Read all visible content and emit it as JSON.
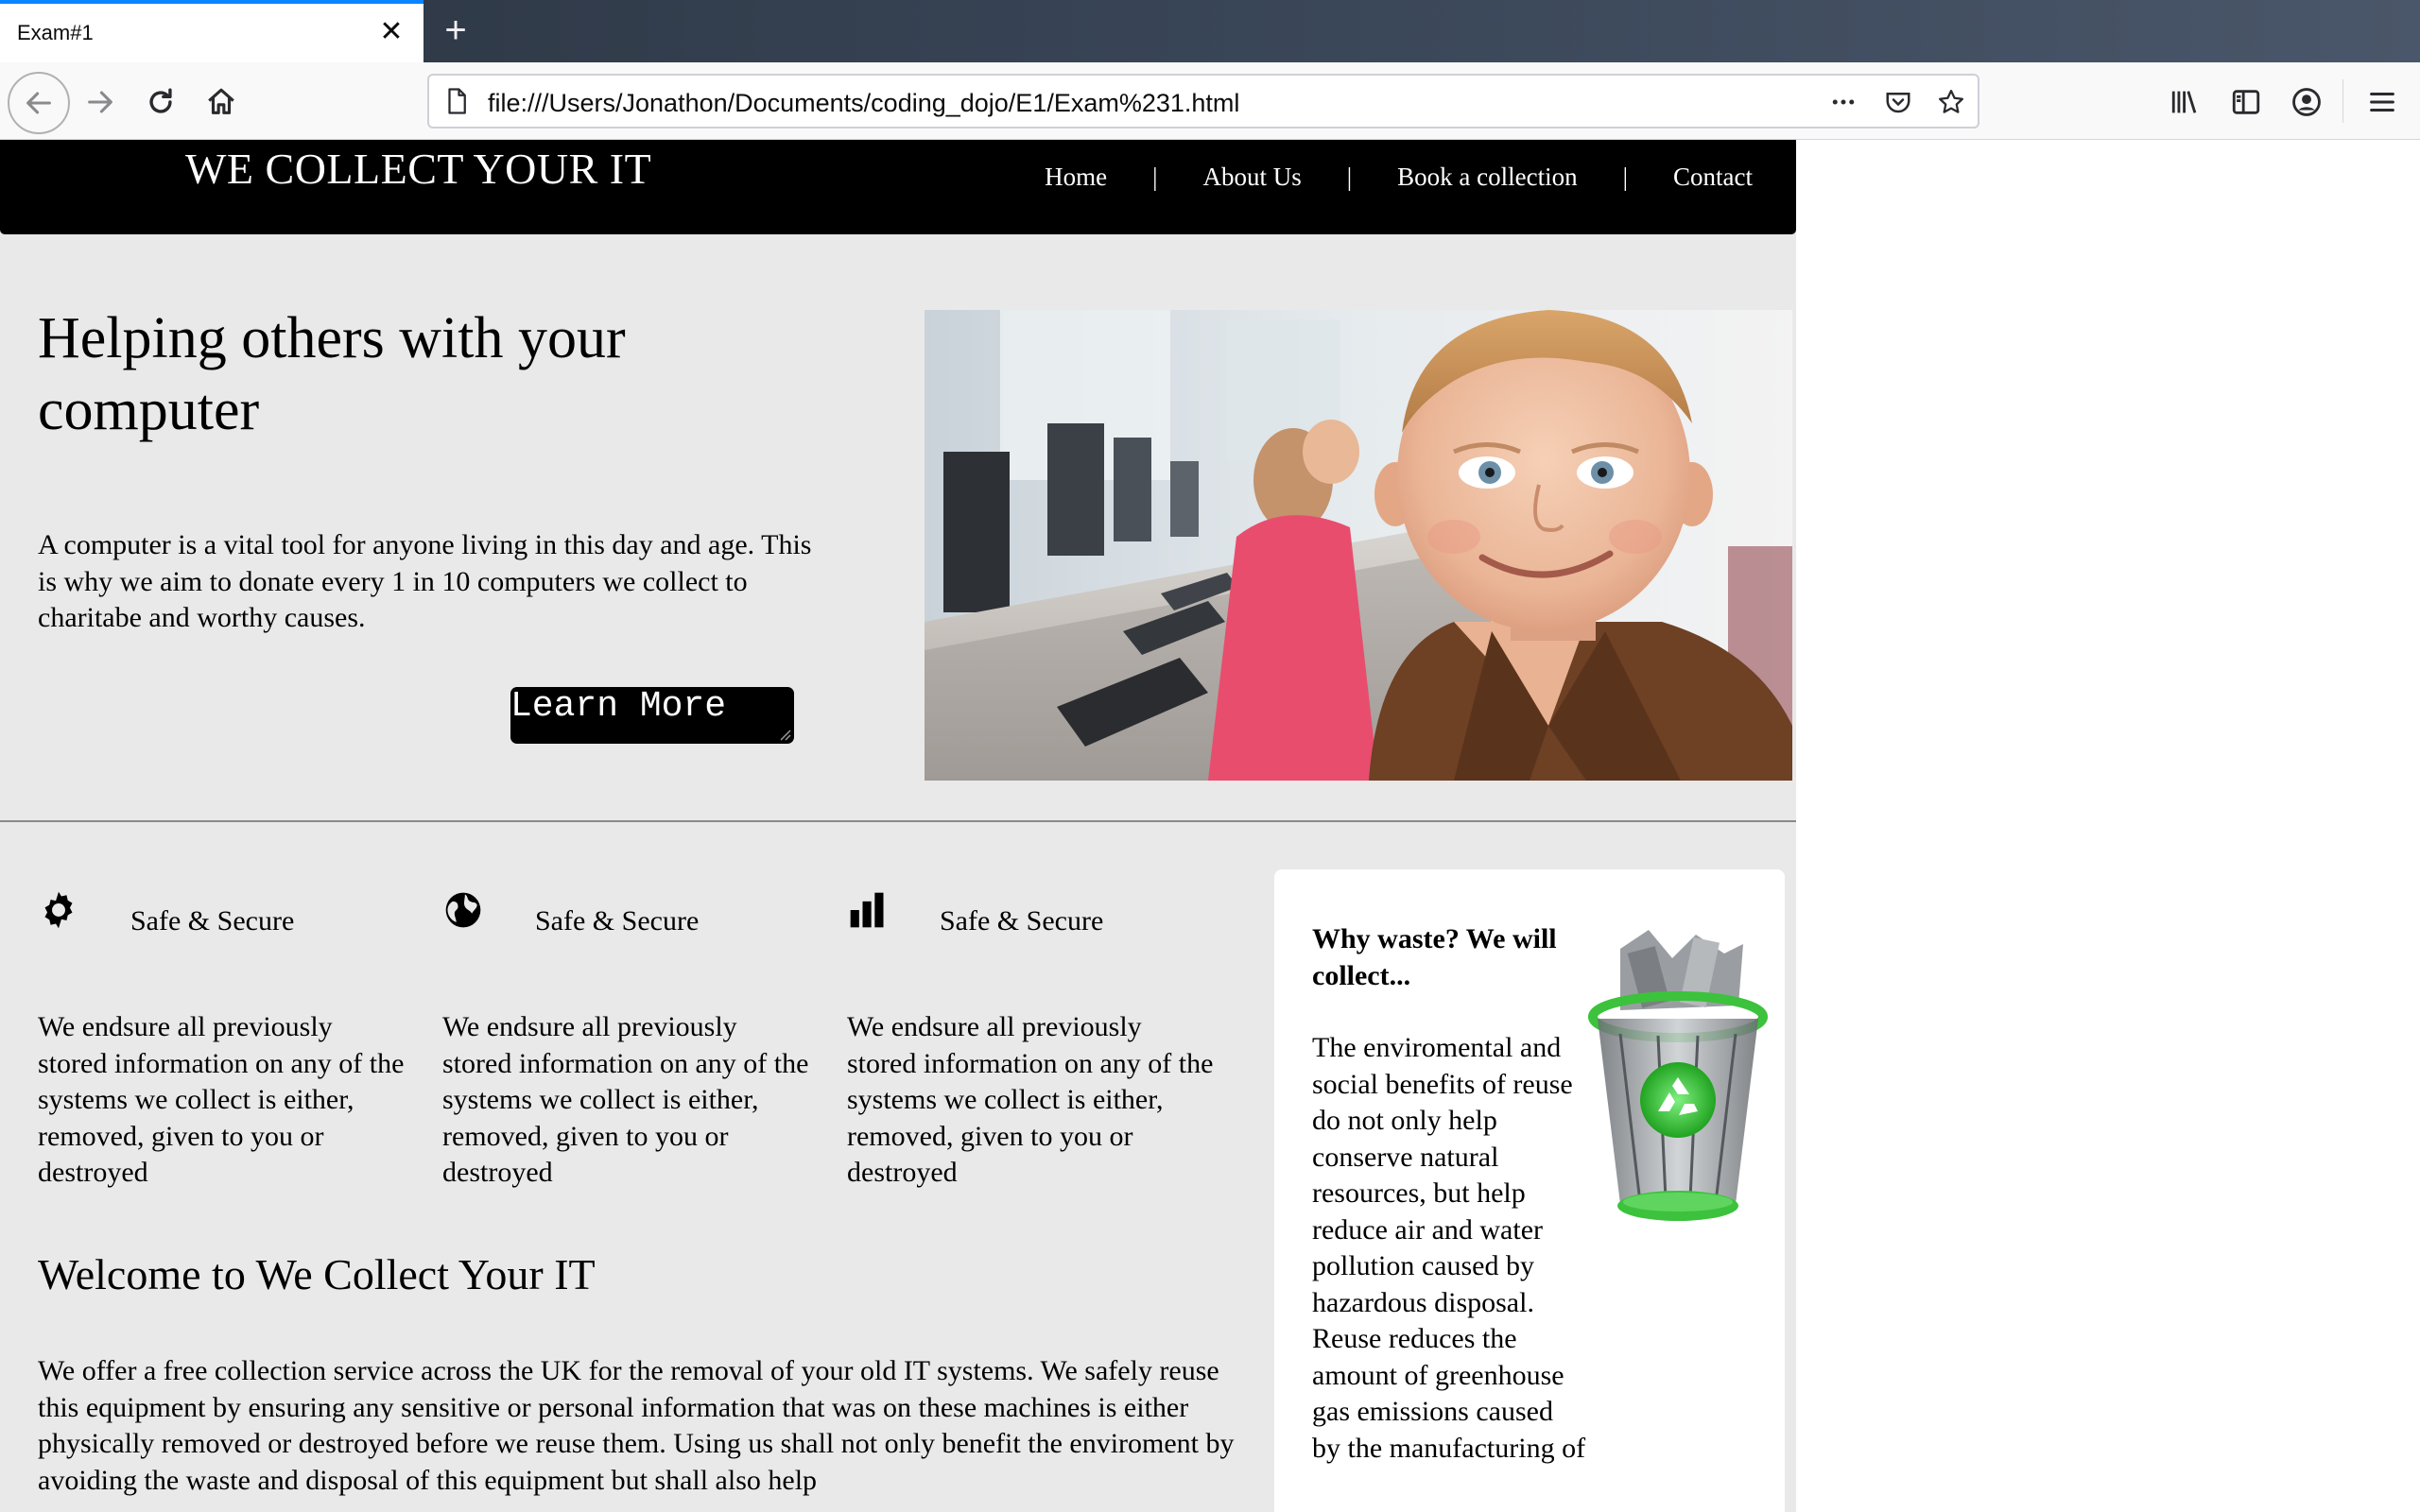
{
  "browser": {
    "tab_title": "Exam#1",
    "tab_close": "✕",
    "new_tab": "+",
    "url": "file:///Users/Jonathon/Documents/coding_dojo/E1/Exam%231.html"
  },
  "site": {
    "logo": "WE COLLECT YOUR IT",
    "nav": [
      {
        "label": "Home"
      },
      {
        "label": "About Us"
      },
      {
        "label": "Book a collection"
      },
      {
        "label": "Contact"
      }
    ],
    "nav_separator": "|",
    "hero": {
      "title": "Helping others with your computer",
      "text": "A computer is a vital tool for anyone living in this day and age. This is why we aim to donate every 1 in 10 computers we collect to charitabe and worthy causes.",
      "button": "Learn More"
    },
    "features": [
      {
        "icon": "gear-icon",
        "title": "Safe & Secure",
        "text": "We endsure all previously stored information on any of the systems we collect is either, removed, given to you or destroyed"
      },
      {
        "icon": "globe-icon",
        "title": "Safe & Secure",
        "text": "We endsure all previously stored information on any of the systems we collect is either, removed, given to you or destroyed"
      },
      {
        "icon": "bar-chart-icon",
        "title": "Safe & Secure",
        "text": "We endsure all previously stored information on any of the systems we collect is either, removed, given to you or destroyed"
      }
    ],
    "welcome": {
      "title": "Welcome to We Collect Your IT",
      "text": "We offer a free collection service across the UK for the removal of your old IT systems. We safely reuse this equipment by ensuring any sensitive or personal information that was on these machines is either physically removed or destroyed before we reuse them. Using us shall not only benefit the enviroment by avoiding the waste and disposal of this equipment but shall also help"
    },
    "aside": {
      "title": "Why waste? We will collect...",
      "text": "The enviromental and social benefits of reuse do not only help conserve natural resources, but help reduce air and water pollution caused by hazardous disposal. Reuse reduces the amount of greenhouse gas emissions caused by the manufacturing of"
    }
  },
  "colors": {
    "header_bg": "#000000",
    "page_bg": "#e9e9e9",
    "button_bg": "#000000",
    "recycle_green": "#3cc23c",
    "tab_accent": "#0a84ff"
  }
}
